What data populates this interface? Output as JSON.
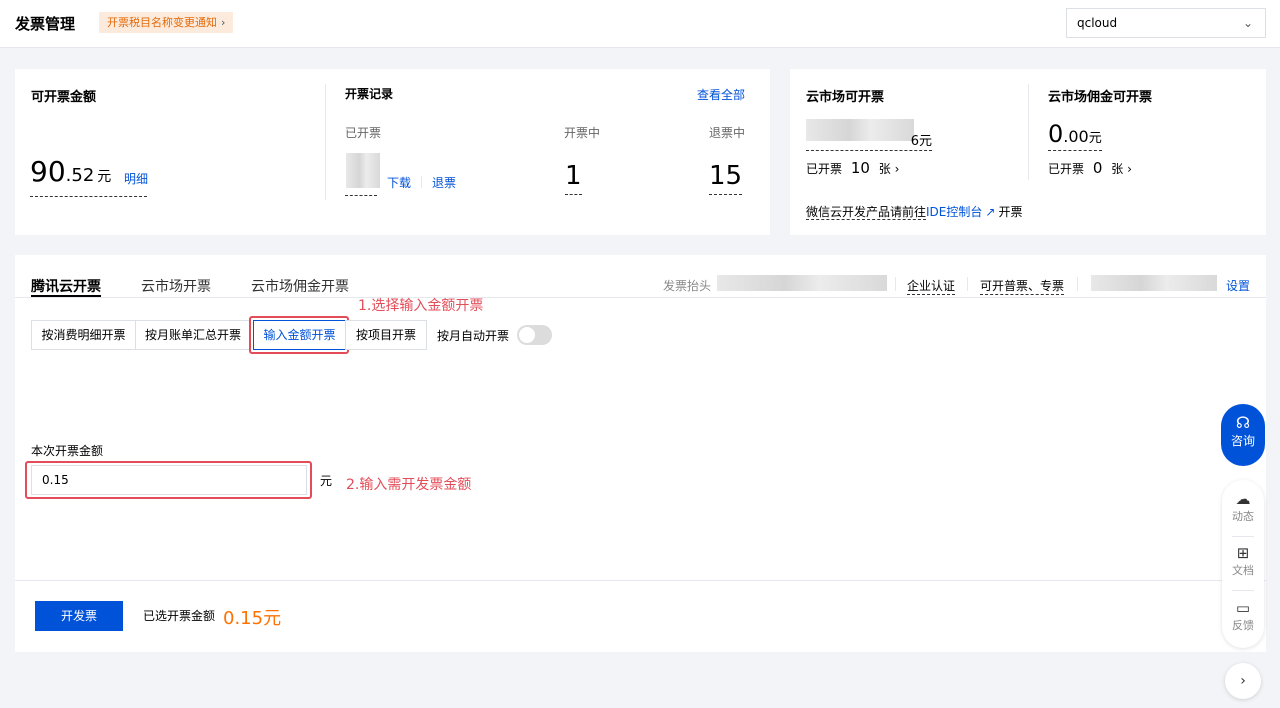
{
  "header": {
    "title": "发票管理",
    "notice": "开票税目名称变更通知",
    "account": "qcloud"
  },
  "available": {
    "title": "可开票金额",
    "amount_int": "90",
    "amount_dec": ".52",
    "unit": "元",
    "detail_link": "明细"
  },
  "records": {
    "title": "开票记录",
    "view_all": "查看全部",
    "issued_label": "已开票",
    "download": "下载",
    "refund": "退票",
    "in_progress_label": "开票中",
    "in_progress_value": "1",
    "refunding_label": "退票中",
    "refunding_value": "15"
  },
  "market": {
    "title": "云市场可开票",
    "amount_suffix": "6元",
    "issued_label": "已开票",
    "issued_count": "10",
    "unit": "张",
    "wechat_note_prefix": "微信云开发产品请前往",
    "wechat_note_link": "IDE控制台",
    "wechat_note_suffix": "开票"
  },
  "commission": {
    "title": "云市场佣金可开票",
    "amount_int": "0",
    "amount_dec": ".00",
    "unit": "元",
    "issued_label": "已开票",
    "issued_count": "0",
    "count_unit": "张"
  },
  "tabs": {
    "items": [
      "腾讯云开票",
      "云市场开票",
      "云市场佣金开票"
    ],
    "header_label": "发票抬头",
    "enterprise_cert": "企业认证",
    "invoice_types": "可开普票、专票",
    "settings": "设置"
  },
  "modes": {
    "items": [
      "按消费明细开票",
      "按月账单汇总开票",
      "输入金额开票",
      "按项目开票"
    ],
    "auto_label": "按月自动开票",
    "auto_enabled": false
  },
  "annotations": {
    "step1": "1.选择输入金额开票",
    "step2": "2.输入需开发票金额"
  },
  "form": {
    "amount_label": "本次开票金额",
    "amount_value": "0.15",
    "unit": "元"
  },
  "footer": {
    "submit": "开发票",
    "selected_label": "已选开票金额",
    "selected_value": "0.15元"
  },
  "side": {
    "consult": "咨询",
    "news": "动态",
    "docs": "文档",
    "feedback": "反馈"
  },
  "colors": {
    "primary": "#0052d9",
    "annotation": "#e34d59",
    "amount": "#ff7200"
  }
}
